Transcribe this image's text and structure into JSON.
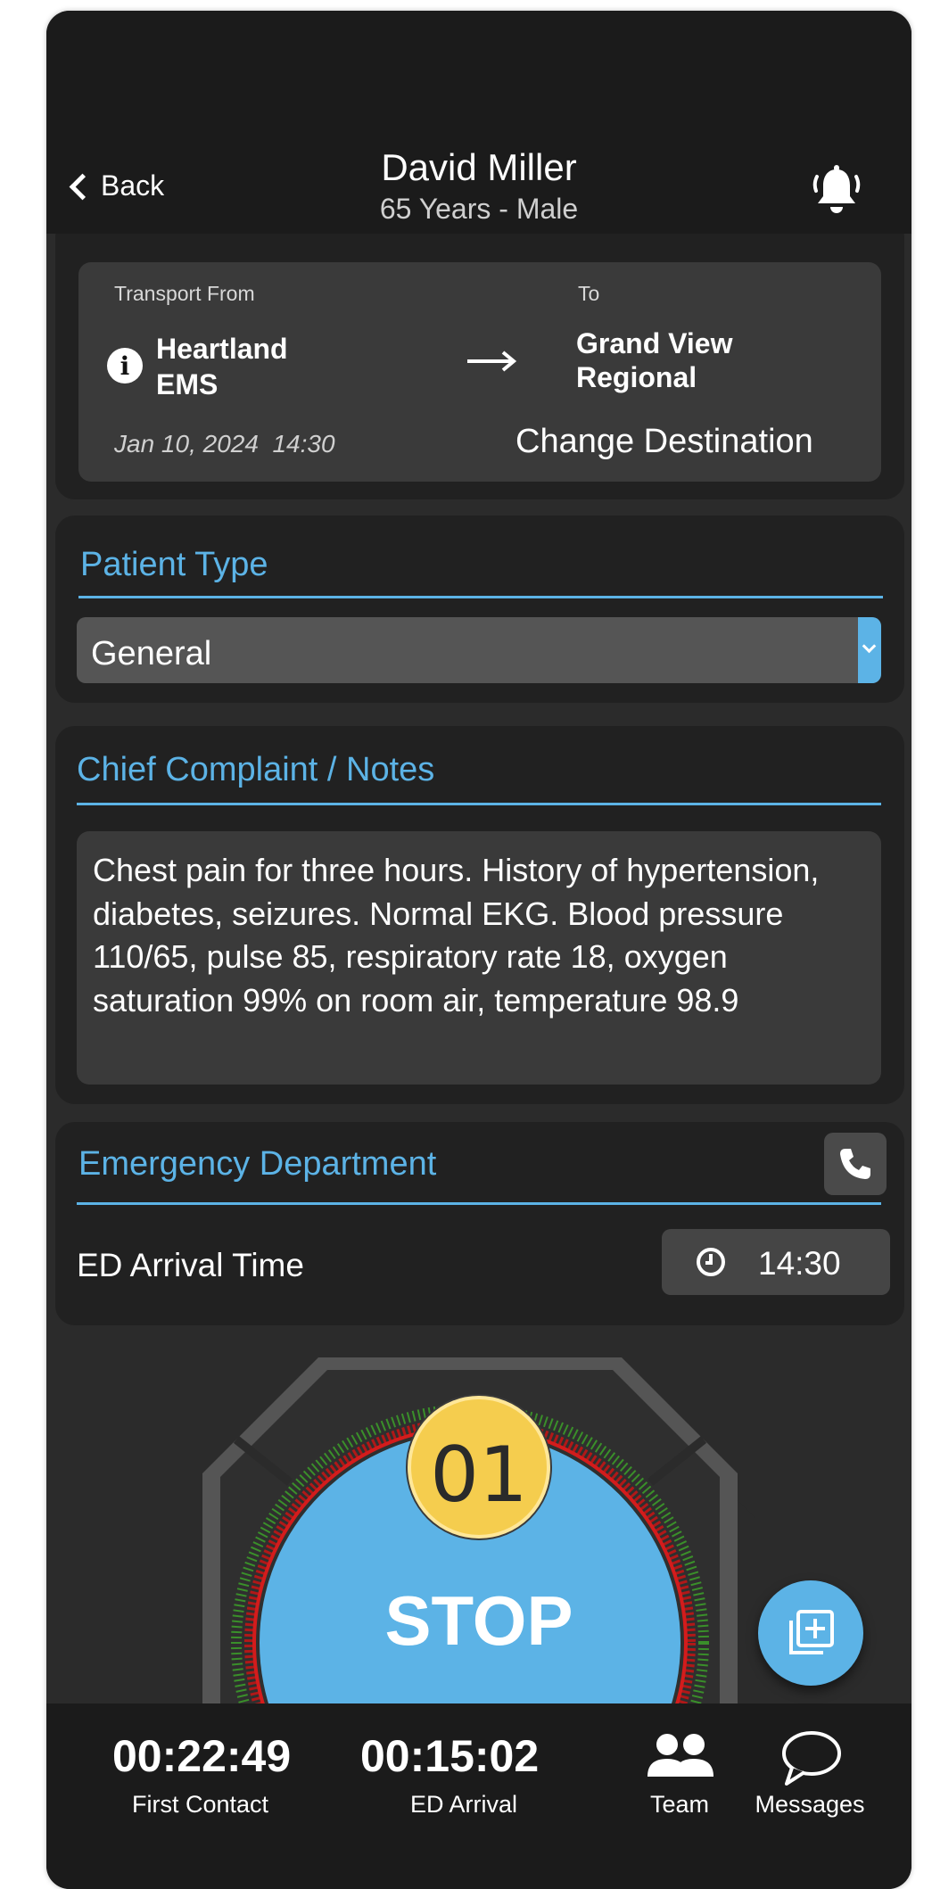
{
  "header": {
    "back_label": "Back",
    "patient_name": "David Miller",
    "patient_info": "65 Years - Male"
  },
  "transport": {
    "from_label": "Transport From",
    "from_place_line1": "Heartland",
    "from_place_line2": "EMS",
    "to_label": "To",
    "to_place_line1": "Grand View",
    "to_place_line2": "Regional",
    "datetime": "Jan 10, 2024  14:30",
    "change_destination_label": "Change Destination"
  },
  "patient_type": {
    "title": "Patient Type",
    "selected": "General"
  },
  "chief_complaint": {
    "title": "Chief Complaint / Notes",
    "text": "Chest pain for three hours. History of hypertension, diabetes, seizures. Normal EKG. Blood pressure 110/65, pulse 85, respiratory rate 18, oxygen saturation 99% on room air, temperature 98.9"
  },
  "emergency_department": {
    "title": "Emergency Department",
    "arrival_label": "ED Arrival Time",
    "arrival_time": "14:30"
  },
  "dial": {
    "badge_number": "01",
    "button_label": "STOP"
  },
  "bottom_bar": {
    "first_contact_time": "00:22:49",
    "first_contact_label": "First Contact",
    "ed_arrival_time": "00:15:02",
    "ed_arrival_label": "ED Arrival",
    "team_label": "Team",
    "messages_label": "Messages"
  },
  "colors": {
    "accent": "#5cb3e6",
    "background": "#2b2b2b",
    "card": "#212121",
    "badge": "#f7d35a"
  },
  "icons": [
    "chevron-left-icon",
    "bell-icon",
    "info-icon",
    "arrow-right-icon",
    "chevron-down-icon",
    "phone-icon",
    "clock-icon",
    "add-note-icon",
    "team-icon",
    "message-icon"
  ]
}
